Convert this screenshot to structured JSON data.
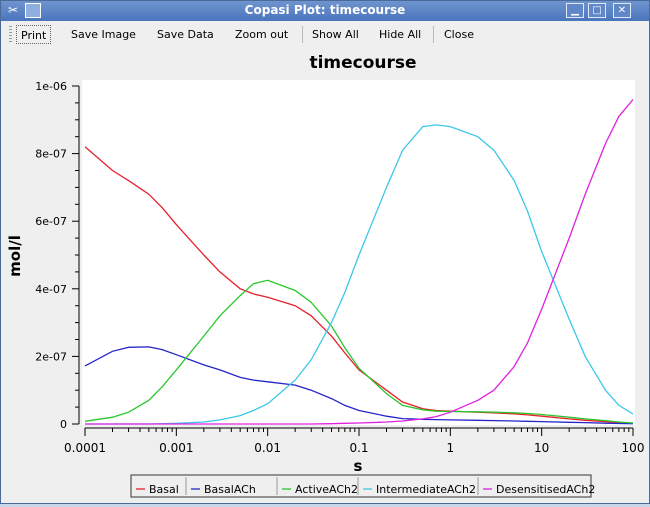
{
  "window": {
    "title": "Copasi Plot: timecourse",
    "app_icon": "scissors-icon"
  },
  "toolbar": {
    "print": "Print",
    "save_image": "Save Image",
    "save_data": "Save Data",
    "zoom_out": "Zoom out",
    "show_all": "Show All",
    "hide_all": "Hide All",
    "close": "Close"
  },
  "chart_data": {
    "type": "line",
    "title": "timecourse",
    "xlabel": "s",
    "ylabel": "mol/l",
    "x_scale": "log",
    "xlim": [
      0.0001,
      100
    ],
    "ylim": [
      0,
      1e-06
    ],
    "x_ticks": [
      "0.0001",
      "0.001",
      "0.01",
      "0.1",
      "1",
      "10",
      "100"
    ],
    "x_tick_values": [
      0.0001,
      0.001,
      0.01,
      0.1,
      1,
      10,
      100
    ],
    "y_ticks": [
      "0",
      "2e-07",
      "4e-07",
      "6e-07",
      "8e-07",
      "1e-06"
    ],
    "y_tick_values": [
      0,
      2e-07,
      4e-07,
      6e-07,
      8e-07,
      1e-06
    ],
    "grid": false,
    "legend_position": "bottom",
    "x": [
      0.0001,
      0.0002,
      0.0003,
      0.0005,
      0.0007,
      0.001,
      0.002,
      0.003,
      0.005,
      0.007,
      0.01,
      0.02,
      0.03,
      0.05,
      0.07,
      0.1,
      0.2,
      0.3,
      0.5,
      0.7,
      1,
      2,
      3,
      5,
      7,
      10,
      20,
      30,
      50,
      70,
      100
    ],
    "series": [
      {
        "name": "Basal",
        "color": "#e8202a",
        "values": [
          8.2e-07,
          7.5e-07,
          7.2e-07,
          6.8e-07,
          6.4e-07,
          5.9e-07,
          5e-07,
          4.5e-07,
          4e-07,
          3.85e-07,
          3.75e-07,
          3.5e-07,
          3.2e-07,
          2.6e-07,
          2.1e-07,
          1.6e-07,
          1e-07,
          6.5e-08,
          4.5e-08,
          4e-08,
          3.8e-08,
          3.5e-08,
          3.3e-08,
          3e-08,
          2.7e-08,
          2.3e-08,
          1.5e-08,
          1.1e-08,
          7e-09,
          4e-09,
          2e-09
        ]
      },
      {
        "name": "BasalACh",
        "color": "#2424c8",
        "values": [
          1.72e-07,
          2.15e-07,
          2.27e-07,
          2.28e-07,
          2.2e-07,
          2.05e-07,
          1.75e-07,
          1.6e-07,
          1.38e-07,
          1.3e-07,
          1.25e-07,
          1.15e-07,
          1e-07,
          7.5e-08,
          5.5e-08,
          4e-08,
          2.3e-08,
          1.6e-08,
          1.4e-08,
          1.3e-08,
          1.2e-08,
          1.1e-08,
          1e-08,
          9e-09,
          8e-09,
          7e-09,
          5e-09,
          4e-09,
          2.5e-09,
          1.5e-09,
          8e-10
        ]
      },
      {
        "name": "ActiveACh2",
        "color": "#28c82c",
        "values": [
          8e-09,
          2e-08,
          3.5e-08,
          7e-08,
          1.1e-07,
          1.6e-07,
          2.6e-07,
          3.2e-07,
          3.8e-07,
          4.15e-07,
          4.25e-07,
          3.95e-07,
          3.6e-07,
          2.9e-07,
          2.25e-07,
          1.65e-07,
          9e-08,
          5.5e-08,
          4.2e-08,
          3.8e-08,
          3.7e-08,
          3.6e-08,
          3.5e-08,
          3.3e-08,
          3.1e-08,
          2.8e-08,
          2e-08,
          1.5e-08,
          1e-08,
          6e-09,
          3e-09
        ]
      },
      {
        "name": "IntermediateACh2",
        "color": "#3cc8e8",
        "values": [
          0,
          0,
          0,
          0,
          1e-09,
          2e-09,
          6e-09,
          1.2e-08,
          2.5e-08,
          4e-08,
          6e-08,
          1.3e-07,
          1.9e-07,
          3e-07,
          3.9e-07,
          5e-07,
          7e-07,
          8.1e-07,
          8.8e-07,
          8.85e-07,
          8.8e-07,
          8.5e-07,
          8.1e-07,
          7.2e-07,
          6.3e-07,
          5.1e-07,
          3.1e-07,
          2e-07,
          1e-07,
          5.5e-08,
          3e-08
        ]
      },
      {
        "name": "DesensitisedACh2",
        "color": "#e020e0",
        "values": [
          0,
          0,
          0,
          0,
          0,
          0,
          0,
          0,
          0,
          0,
          0,
          0,
          0,
          1e-09,
          2e-09,
          3e-09,
          6e-09,
          9e-09,
          1.5e-08,
          2.2e-08,
          3.5e-08,
          7e-08,
          1e-07,
          1.7e-07,
          2.4e-07,
          3.4e-07,
          5.5e-07,
          6.8e-07,
          8.3e-07,
          9.1e-07,
          9.6e-07
        ]
      }
    ]
  }
}
